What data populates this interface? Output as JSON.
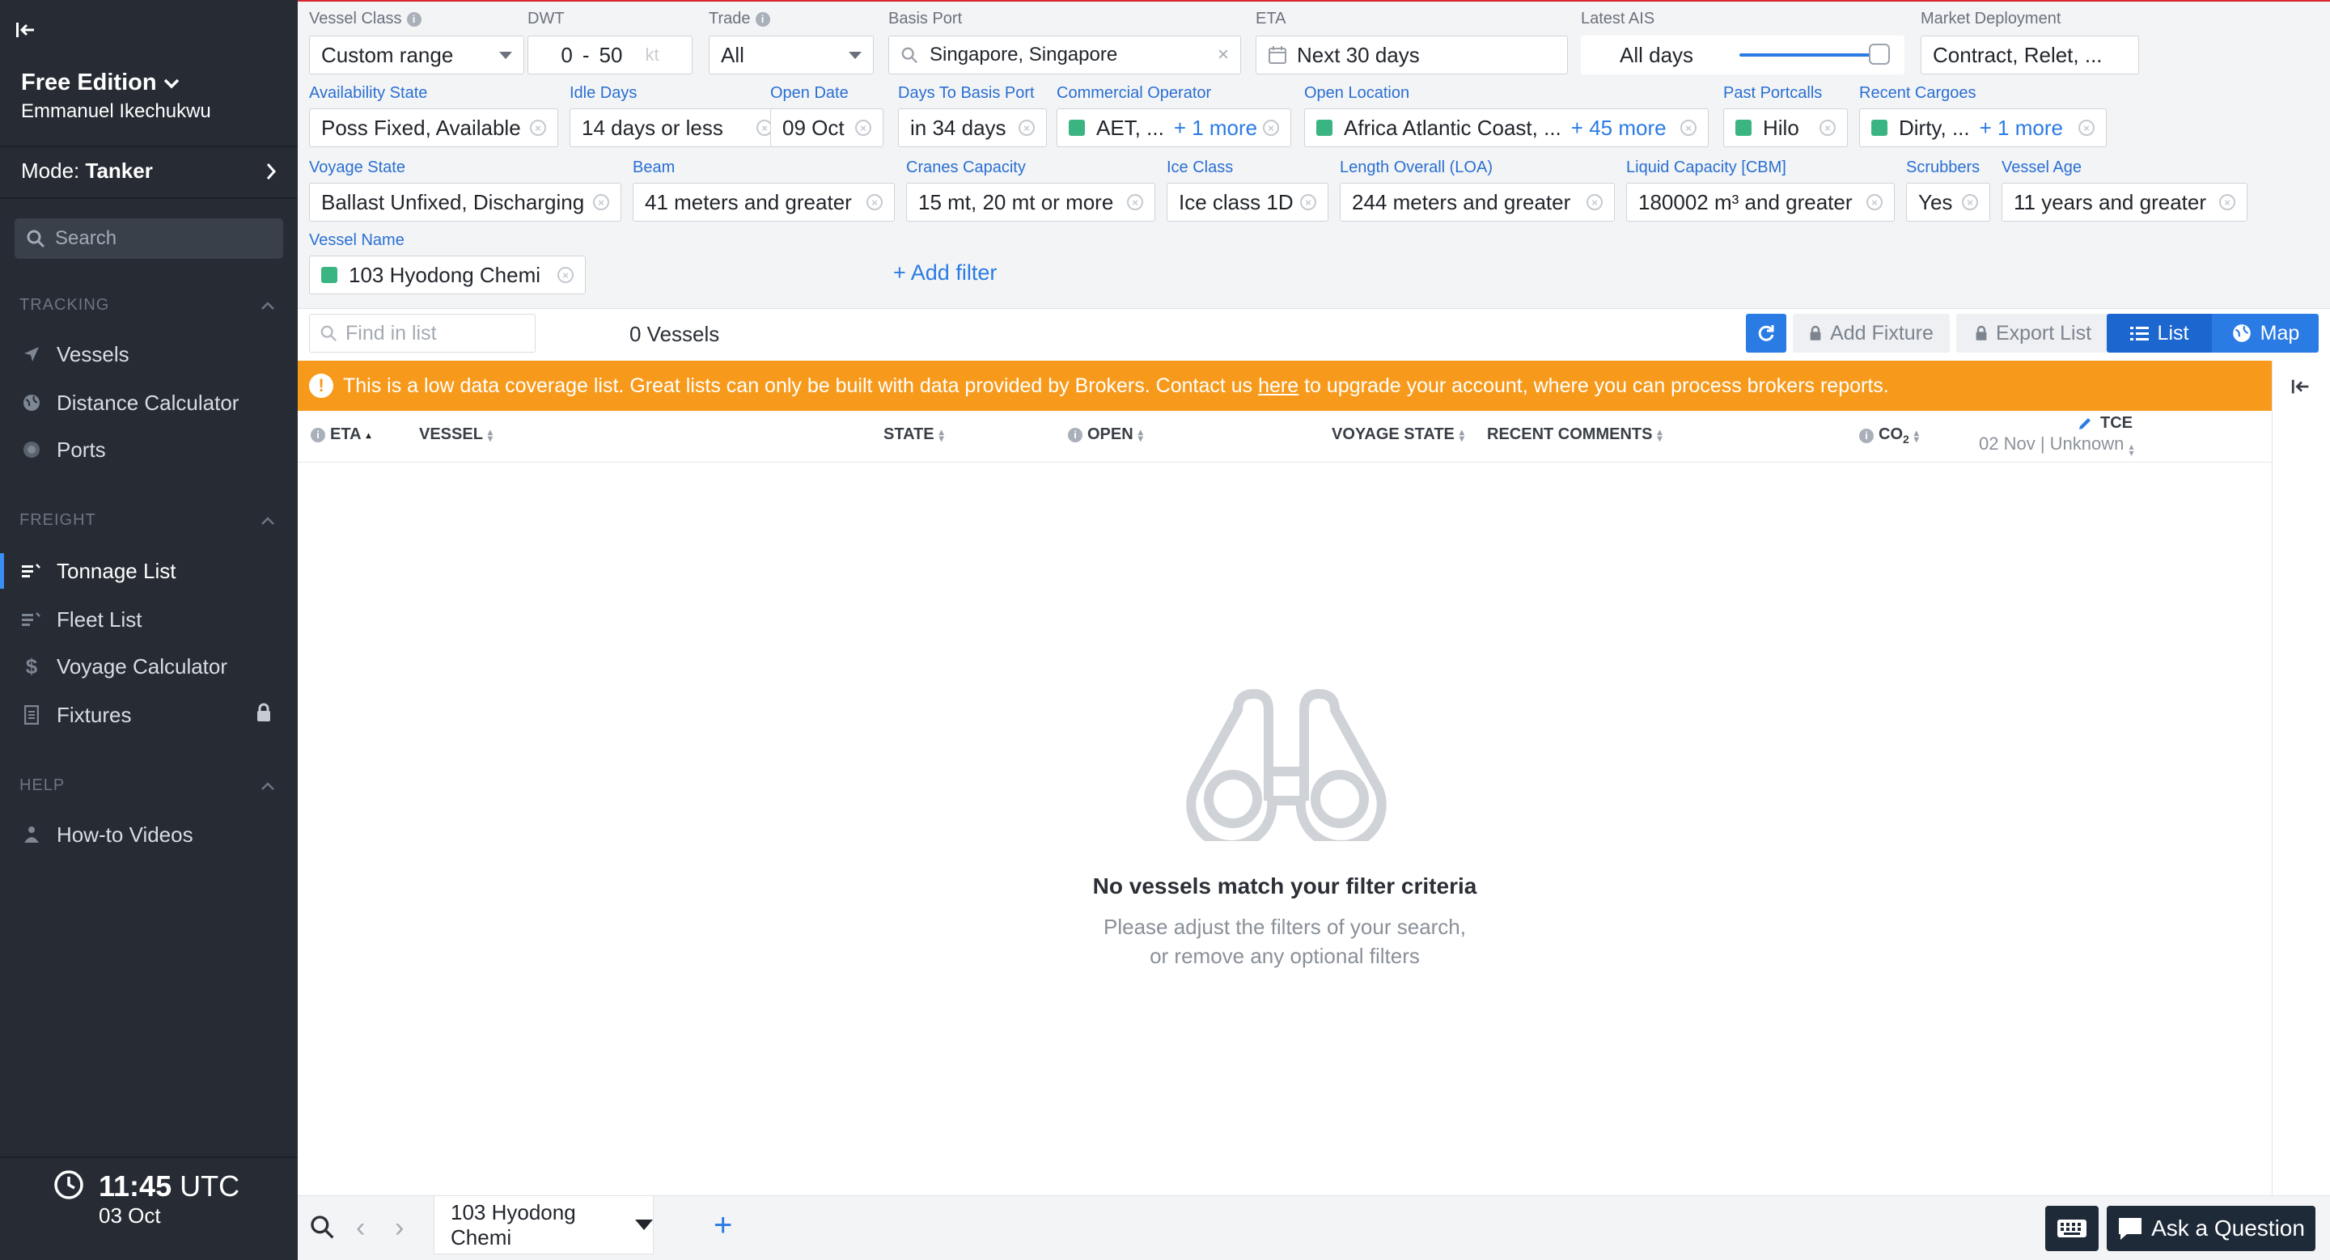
{
  "sidebar": {
    "edition": "Free Edition",
    "user": "Emmanuel Ikechukwu",
    "mode_label": "Mode:",
    "mode_value": "Tanker",
    "search_placeholder": "Search",
    "sections": {
      "tracking": "TRACKING",
      "freight": "FREIGHT",
      "help": "HELP"
    },
    "tracking_items": [
      {
        "label": "Vessels",
        "icon": "send-arrow-icon"
      },
      {
        "label": "Distance Calculator",
        "icon": "globe-icon"
      },
      {
        "label": "Ports",
        "icon": "port-dot-icon"
      }
    ],
    "freight_items": [
      {
        "label": "Tonnage List",
        "icon": "list-icon",
        "active": true
      },
      {
        "label": "Fleet List",
        "icon": "list-icon"
      },
      {
        "label": "Voyage Calculator",
        "icon": "dollar-icon"
      },
      {
        "label": "Fixtures",
        "icon": "document-icon",
        "locked": true
      }
    ],
    "help_items": [
      {
        "label": "How-to Videos",
        "icon": "person-icon"
      }
    ],
    "clock": {
      "time": "11:45",
      "tz": "UTC",
      "date": "03 Oct"
    }
  },
  "filters": {
    "vessel_class": {
      "label": "Vessel Class",
      "value": "Custom range"
    },
    "dwt": {
      "label": "DWT",
      "from": "0",
      "sep": "-",
      "to": "50",
      "unit": "kt"
    },
    "trade": {
      "label": "Trade",
      "value": "All"
    },
    "basis_port": {
      "label": "Basis Port",
      "value": "Singapore, Singapore"
    },
    "eta": {
      "label": "ETA",
      "value": "Next 30 days"
    },
    "latest_ais": {
      "label": "Latest AIS",
      "value": "All days",
      "slider_fraction": 1.0
    },
    "market_deployment": {
      "label": "Market Deployment",
      "value": "Contract, Relet, ..."
    },
    "availability_state": {
      "label": "Availability State",
      "value": "Poss Fixed, Available"
    },
    "idle_days": {
      "label": "Idle Days",
      "value": "14 days or less"
    },
    "open_date": {
      "label": "Open Date",
      "value": "09 Oct"
    },
    "days_to_basis_port": {
      "label": "Days To Basis Port",
      "value": "in 34 days"
    },
    "commercial_operator": {
      "label": "Commercial Operator",
      "value": "AET, ...",
      "more": "+ 1 more"
    },
    "open_location": {
      "label": "Open Location",
      "value": "Africa Atlantic Coast, ...",
      "more": "+ 45 more"
    },
    "past_portcalls": {
      "label": "Past Portcalls",
      "value": "Hilo"
    },
    "recent_cargoes": {
      "label": "Recent Cargoes",
      "value": "Dirty, ...",
      "more": "+ 1 more"
    },
    "voyage_state": {
      "label": "Voyage State",
      "value": "Ballast Unfixed, Discharging"
    },
    "beam": {
      "label": "Beam",
      "value": "41 meters and greater"
    },
    "cranes_capacity": {
      "label": "Cranes Capacity",
      "value": "15 mt, 20 mt or more"
    },
    "ice_class": {
      "label": "Ice Class",
      "value": "Ice class 1D"
    },
    "loa": {
      "label": "Length Overall (LOA)",
      "value": "244 meters and greater"
    },
    "liquid_capacity": {
      "label": "Liquid Capacity [CBM]",
      "value": "180002 m³ and greater"
    },
    "scrubbers": {
      "label": "Scrubbers",
      "value": "Yes"
    },
    "vessel_age": {
      "label": "Vessel Age",
      "value": "11 years and greater"
    },
    "vessel_name": {
      "label": "Vessel Name",
      "value": "103 Hyodong Chemi"
    },
    "add_filter": "+ Add filter"
  },
  "toolbar": {
    "find_placeholder": "Find in list",
    "vessel_count": "0 Vessels",
    "add_fixture": "Add Fixture",
    "export_list": "Export List",
    "list": "List",
    "map": "Map"
  },
  "banner": {
    "text_before": "This is a low data coverage list. Great lists can only be built with data provided by Brokers. Contact us",
    "link": "here",
    "text_after": "to upgrade your account, where you can process brokers reports."
  },
  "table": {
    "columns": {
      "eta": "ETA",
      "vessel": "VESSEL",
      "state": "STATE",
      "open": "OPEN",
      "voyage_state": "VOYAGE STATE",
      "recent_comments": "RECENT COMMENTS",
      "co2": "CO",
      "co2_sub": "2",
      "tce": "TCE",
      "tce_sub": "02 Nov | Unknown"
    },
    "empty_title": "No vessels match your filter criteria",
    "empty_line1": "Please adjust the filters of your search,",
    "empty_line2": "or remove any optional filters"
  },
  "bottom": {
    "tab_label": "103 Hyodong Chemi",
    "ask": "Ask a Question"
  },
  "colors": {
    "accent": "#2a7be4",
    "sidebar": "#262b34",
    "banner": "#f79a1b",
    "tag": "#3ab582",
    "topline": "#d7262e"
  }
}
